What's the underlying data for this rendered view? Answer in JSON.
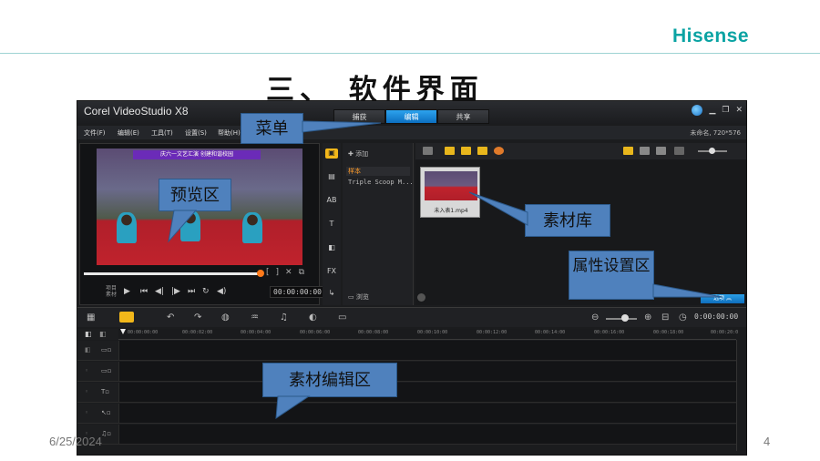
{
  "slide": {
    "logo": "Hisense",
    "title": "三、 软件界面",
    "date": "6/25/2024",
    "page_number": "4"
  },
  "app": {
    "title": "Corel VideoStudio X8",
    "step_tabs": [
      {
        "label": "捕获",
        "active": false
      },
      {
        "label": "编辑",
        "active": true
      },
      {
        "label": "共享",
        "active": false
      }
    ],
    "window_controls": [
      "globe-icon",
      "minimize-icon",
      "restore-icon",
      "close-icon"
    ],
    "menu": [
      "文件(F)",
      "编辑(E)",
      "工具(T)",
      "设置(S)",
      "帮助(H)"
    ],
    "project_info": "未命名, 720*576",
    "preview": {
      "banner": "庆六一文艺汇演 创建和谐校园",
      "mode_labels": [
        "项目",
        "素材"
      ],
      "timecode": "00:00:00:00"
    },
    "library": {
      "add_label": "添加",
      "folders": [
        {
          "label": "样本",
          "active": true
        },
        {
          "label": "Triple Scoop M...",
          "active": false
        }
      ],
      "browse_label": "浏览",
      "thumbnail_label": "未入表1.mp4",
      "options_button": "选项"
    },
    "timeline": {
      "timecode": "0:00:00:00",
      "ruler": [
        "00:00:00:00",
        "00:00:02:00",
        "00:00:04:00",
        "00:00:06:00",
        "00:00:08:00",
        "00:00:10:00",
        "00:00:12:00",
        "00:00:14:00",
        "00:00:16:00",
        "00:00:18:00",
        "00:00:20:0"
      ],
      "tracks": [
        "video-track",
        "overlay-track",
        "title-track",
        "voice-track",
        "music-track"
      ]
    }
  },
  "callouts": {
    "menu": "菜单",
    "preview": "预览区",
    "library": "素材库",
    "properties": "属性设置区",
    "timeline": "素材编辑区"
  },
  "colors": {
    "accent": "#0C6FC0",
    "brand": "#0AA3A3",
    "callout": "#4F81BD",
    "highlight": "#F2B71A"
  }
}
